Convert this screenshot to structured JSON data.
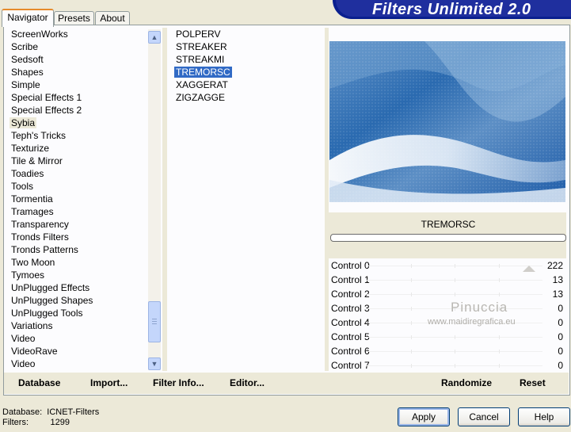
{
  "tabs": [
    "Navigator",
    "Presets",
    "About"
  ],
  "app_title": "Filters Unlimited 2.0",
  "categories": [
    "ScreenWorks",
    "Scribe",
    "Sedsoft",
    "Shapes",
    "Simple",
    "Special Effects 1",
    "Special Effects 2",
    "Sybia",
    "Teph's Tricks",
    "Texturize",
    "Tile & Mirror",
    "Toadies",
    "Tools",
    "Tormentia",
    "Tramages",
    "Transparency",
    "Tronds Filters",
    "Tronds Patterns",
    "Two Moon",
    "Tymoes",
    "UnPlugged Effects",
    "UnPlugged Shapes",
    "UnPlugged Tools",
    "Variations",
    "Video",
    "VideoRave",
    "Video"
  ],
  "selected_category": "Sybia",
  "filters": [
    "POLPERV",
    "STREAKER",
    "STREAKMI",
    "TREMORSC",
    "XAGGERAT",
    "ZIGZAGGE"
  ],
  "selected_filter": "TREMORSC",
  "preview_filter_name": "TREMORSC",
  "controls": [
    {
      "label": "Control 0",
      "value": "222"
    },
    {
      "label": "Control 1",
      "value": "13"
    },
    {
      "label": "Control 2",
      "value": "13"
    },
    {
      "label": "Control 3",
      "value": "0"
    },
    {
      "label": "Control 4",
      "value": "0"
    },
    {
      "label": "Control 5",
      "value": "0"
    },
    {
      "label": "Control 6",
      "value": "0"
    },
    {
      "label": "Control 7",
      "value": "0"
    }
  ],
  "watermark": {
    "name": "Pinuccia",
    "url": "www.maidiregrafica.eu"
  },
  "bottom_buttons": {
    "database": "Database",
    "import": "Import...",
    "filter_info": "Filter Info...",
    "editor": "Editor...",
    "randomize": "Randomize",
    "reset": "Reset"
  },
  "status": {
    "db_label": "Database:",
    "db_value": "ICNET-Filters",
    "filters_label": "Filters:",
    "filters_value": "1299"
  },
  "dialog_buttons": {
    "apply": "Apply",
    "cancel": "Cancel",
    "help": "Help"
  },
  "colors": {
    "accent": "#316ac5",
    "banner": "#0a1f8f",
    "preview_blue": "#2f70b5",
    "tab_highlight": "#e68b2c"
  }
}
